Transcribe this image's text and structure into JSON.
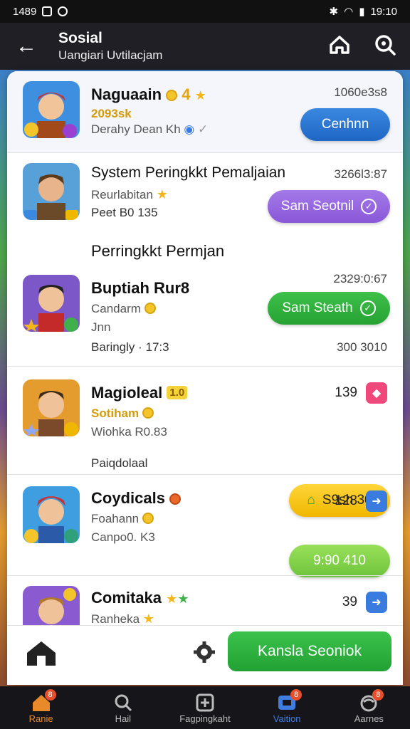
{
  "status_bar": {
    "time_left": "1489",
    "time_right": "19:10"
  },
  "app_bar": {
    "title": "Sosial",
    "subtitle": "Uangiari Uvtilacjam"
  },
  "rows": [
    {
      "name": "Naguaain",
      "badge": "4",
      "sub1": "2093sk",
      "sub2": "Derahy Dean Kh",
      "score": "1060e3s8",
      "button": "Cenhnn"
    },
    {
      "name": "System Peringkkt Pemaljaian",
      "sub1": "Reurlabitan",
      "sub2": "Peet B0 135",
      "score": "3266l3:87",
      "button": "Sam Seotnil"
    },
    {
      "name": "Buptiah Rur8",
      "sub1": "Candarm",
      "sub2": "Jnn",
      "sub3": "Baringly · 17:3",
      "score": "2329:0:67",
      "score2": "300 3010",
      "button": "Sam Steath"
    },
    {
      "name": "Magioleal",
      "badge": "1.0",
      "sub1": "Sotiham",
      "sub2": "Wiohka R0.83",
      "sub3": "Paiqdolaal",
      "score": "139",
      "button": "S9sh 30"
    },
    {
      "name": "Coydicals",
      "sub1": "Foahann",
      "sub2": "Canpo0. K3",
      "score": "128",
      "button": "9:90 410"
    },
    {
      "name": "Comitaka",
      "sub1": "Ranheka",
      "score": "39"
    }
  ],
  "section_title": "Perringkkt Permjan",
  "bottom_button": "Kansla Seoniok",
  "nav": [
    {
      "label": "Ranie"
    },
    {
      "label": "Hail"
    },
    {
      "label": "Fagpingkaht"
    },
    {
      "label": "Vaition"
    },
    {
      "label": "Aarnes"
    }
  ],
  "nav_badges": [
    "8",
    "8",
    "8"
  ],
  "colors": {
    "blue": "#1f66c4",
    "purple": "#8a57d8",
    "green": "#26a233",
    "yellow": "#f0b700",
    "accent_orange": "#e88a2a"
  }
}
